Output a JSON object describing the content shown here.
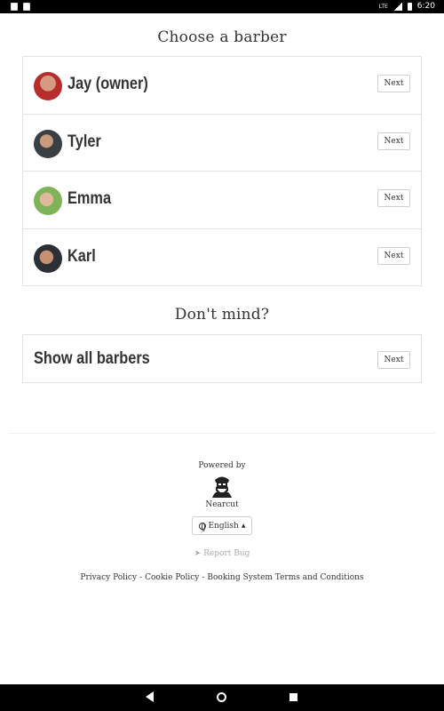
{
  "status_bar": {
    "time": "6:20",
    "network": "LTE"
  },
  "page": {
    "title": "Choose a barber",
    "barbers": [
      {
        "name": "Jay (owner)",
        "next_label": "Next"
      },
      {
        "name": "Tyler",
        "next_label": "Next"
      },
      {
        "name": "Emma",
        "next_label": "Next"
      },
      {
        "name": "Karl",
        "next_label": "Next"
      }
    ],
    "dont_mind_title": "Don't mind?",
    "show_all": {
      "label": "Show all barbers",
      "next_label": "Next"
    }
  },
  "footer": {
    "powered_by": "Powered by",
    "brand": "Nearcut",
    "language": "English",
    "report_bug": "Report Bug",
    "links": {
      "privacy": "Privacy Policy",
      "cookie": "Cookie Policy",
      "terms": "Booking System Terms and Conditions",
      "separator": "-"
    }
  },
  "icons": {
    "logo": "bearded-barber-icon",
    "language": "globe-icon",
    "report": "paper-plane-icon"
  },
  "colors": {
    "text": "#333333",
    "border": "#e3e3e3",
    "muted": "#aaaaaa",
    "background": "#ffffff"
  }
}
